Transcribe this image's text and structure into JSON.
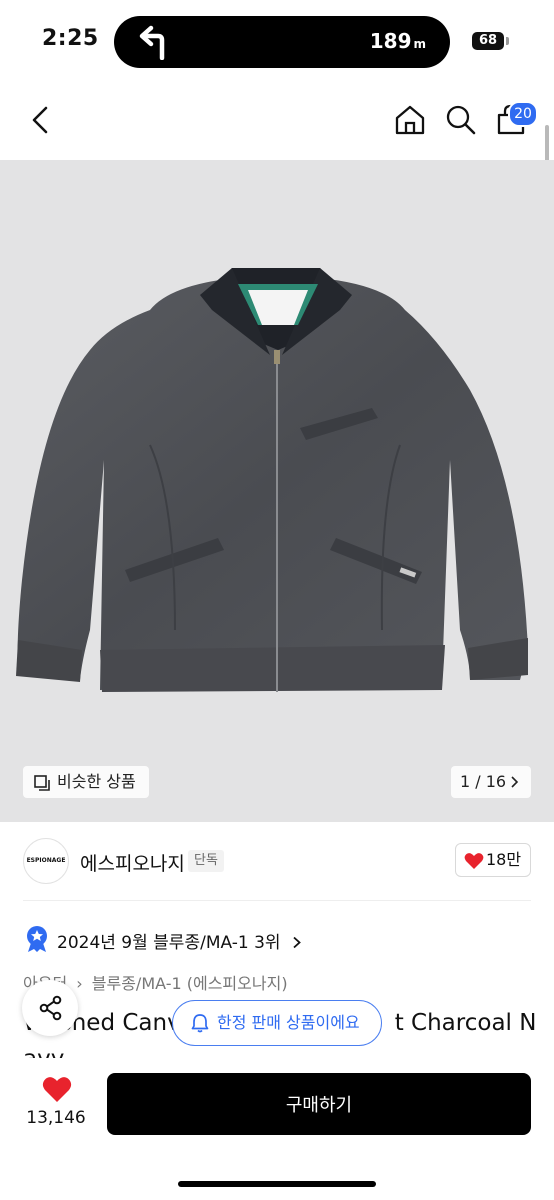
{
  "status_bar": {
    "time": "2:25",
    "nav_distance": "189",
    "nav_unit": "m",
    "battery": "68"
  },
  "header": {
    "cart_count": "20"
  },
  "gallery": {
    "similar_label": "비슷한 상품",
    "pager": "1 / 16"
  },
  "brand": {
    "logo_text": "ESPIONAGE",
    "name": "에스피오나지",
    "exclusive_label": "단독",
    "like_count": "18만"
  },
  "ranking": {
    "text": "2024년 9월 블루종/MA-1 3위"
  },
  "breadcrumb": {
    "category": "아우터",
    "subcategory": "블루종/MA-1 (에스피오나지)"
  },
  "product": {
    "title_line1_left": "W",
    "title_line1_mid": "shed Canv",
    "title_line1_right": "t Charcoal N",
    "title_line2": "avy"
  },
  "toast": {
    "text": "한정 판매 상품이에요"
  },
  "bottom_bar": {
    "favorite_count": "13,146",
    "buy_label": "구매하기"
  },
  "colors": {
    "accent": "#2f6bf1",
    "like": "#e8232d",
    "button": "#000000"
  }
}
